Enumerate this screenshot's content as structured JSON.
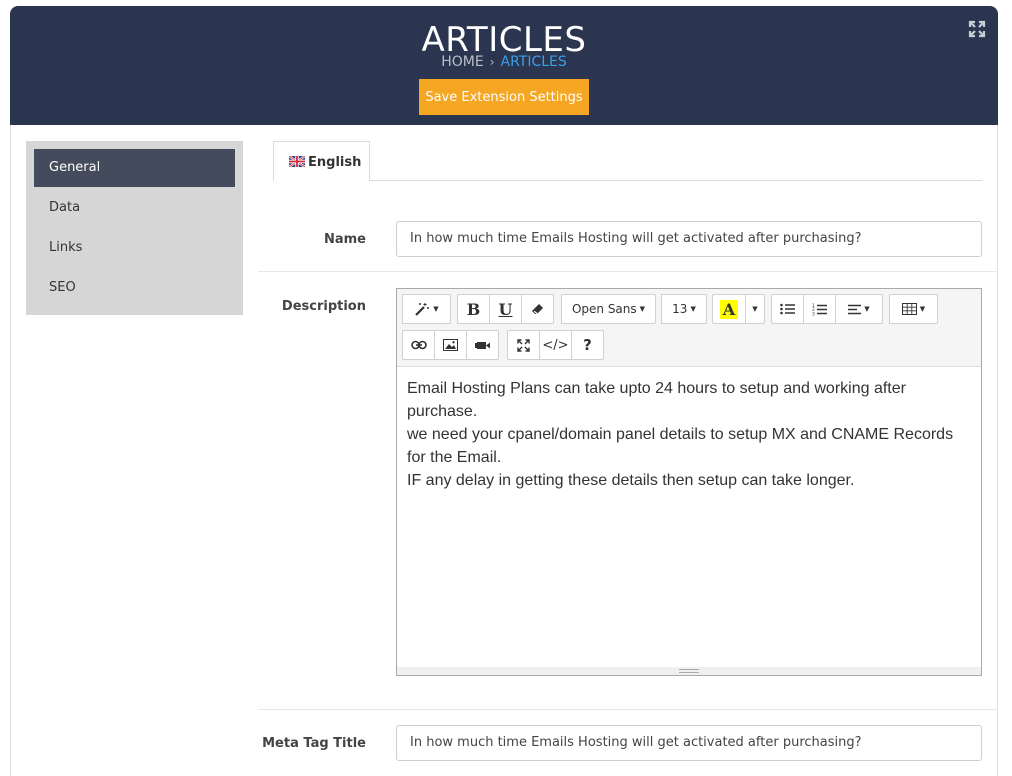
{
  "header": {
    "title": "ARTICLES",
    "breadcrumb_home": "HOME",
    "breadcrumb_sep": "›",
    "breadcrumb_current": "ARTICLES",
    "save_label": "Save Extension Settings"
  },
  "sidebar": {
    "items": [
      {
        "label": "General",
        "active": true
      },
      {
        "label": "Data"
      },
      {
        "label": "Links"
      },
      {
        "label": "SEO"
      }
    ]
  },
  "tabs": [
    {
      "label": "English",
      "icon": "uk-flag-icon"
    }
  ],
  "form": {
    "name_label": "Name",
    "name_value": "In how much time Emails Hosting will get activated after purchasing?",
    "description_label": "Description",
    "meta_title_label": "Meta Tag Title",
    "meta_title_value": "In how much time Emails Hosting will get activated after purchasing?"
  },
  "editor": {
    "font_family": "Open Sans",
    "font_size": "13",
    "bold_label": "B",
    "underline_label": "U",
    "highlight_label": "A",
    "code_label": "</>",
    "help_label": "?",
    "content": [
      "Email Hosting Plans can take upto 24 hours to setup and working after purchase.",
      "we need your cpanel/domain panel details to setup MX and CNAME Records for the Email.",
      "IF any delay in getting these details then setup can take longer."
    ]
  },
  "colors": {
    "header_bg": "#2b3550",
    "accent": "#f5a623",
    "breadcrumb_active": "#3aa0e8",
    "nav_active": "#444b5c"
  }
}
